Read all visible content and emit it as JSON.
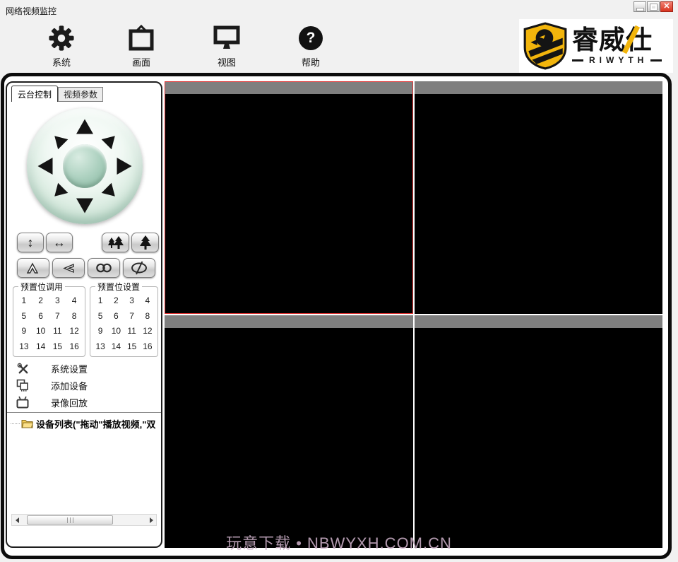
{
  "window": {
    "title": "网络视频监控",
    "controls": {
      "close_glyph": "✕"
    }
  },
  "toolbar": {
    "help_glyph": "?",
    "items": [
      {
        "id": "system",
        "label": "系统"
      },
      {
        "id": "screen",
        "label": "画面"
      },
      {
        "id": "view",
        "label": "视图"
      },
      {
        "id": "help",
        "label": "帮助"
      }
    ]
  },
  "logo": {
    "brand": "睿威仕",
    "tagline": "RIWYTH"
  },
  "ptz": {
    "tabs": [
      {
        "label": "云台控制",
        "active": true
      },
      {
        "label": "视频参数",
        "active": false
      }
    ],
    "row1": [
      {
        "name": "vertical-scan",
        "glyph": "↕"
      },
      {
        "name": "horizontal-scan",
        "glyph": "↔"
      }
    ]
  },
  "preset_call": {
    "title": "预置位调用",
    "numbers": [
      "1",
      "2",
      "3",
      "4",
      "5",
      "6",
      "7",
      "8",
      "9",
      "10",
      "11",
      "12",
      "13",
      "14",
      "15",
      "16"
    ]
  },
  "preset_set": {
    "title": "预置位设置",
    "numbers": [
      "1",
      "2",
      "3",
      "4",
      "5",
      "6",
      "7",
      "8",
      "9",
      "10",
      "11",
      "12",
      "13",
      "14",
      "15",
      "16"
    ]
  },
  "menu": {
    "items": [
      {
        "id": "system-settings",
        "label": "系统设置"
      },
      {
        "id": "add-device",
        "label": "添加设备"
      },
      {
        "id": "playback",
        "label": "录像回放"
      }
    ]
  },
  "device_tree": {
    "root_label": "设备列表(\"拖动\"播放视频,\"双"
  },
  "video_grid": {
    "cells": [
      {
        "id": 1,
        "selected": true
      },
      {
        "id": 2,
        "selected": false
      },
      {
        "id": 3,
        "selected": false
      },
      {
        "id": 4,
        "selected": false
      }
    ]
  },
  "watermark": {
    "text": "玩意下载 • NBWYXH.COM.CN"
  },
  "colors": {
    "header_gray": "#7f7f7f",
    "selection_red": "#df3333",
    "logo_yellow": "#f2b50c",
    "close_red": "#d9331f"
  }
}
